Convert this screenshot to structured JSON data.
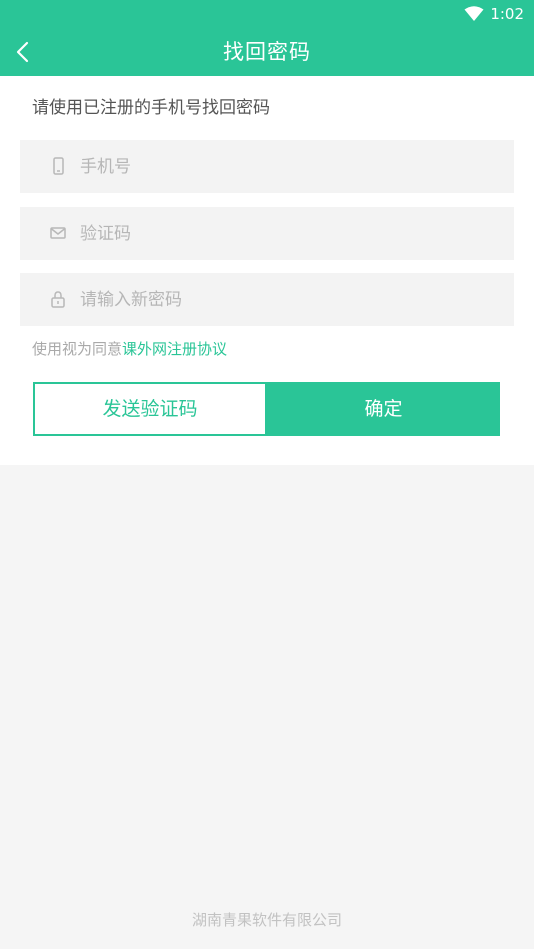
{
  "status_bar": {
    "time": "1:02",
    "wifi_icon": "wifi-icon",
    "background": "#2ac597"
  },
  "header": {
    "title": "找回密码",
    "back_icon": "chevron-left-icon"
  },
  "form": {
    "hint": "请使用已注册的手机号找回密码",
    "phone": {
      "placeholder": "手机号",
      "value": "",
      "icon": "phone-icon"
    },
    "code": {
      "placeholder": "验证码",
      "value": "",
      "icon": "mail-icon"
    },
    "password": {
      "placeholder": "请输入新密码",
      "value": "",
      "icon": "lock-icon"
    },
    "agreement_prefix": "使用视为同意",
    "agreement_link": "课外网注册协议",
    "send_code_label": "发送验证码",
    "confirm_label": "确定"
  },
  "footer": {
    "company": "湖南青果软件有限公司"
  },
  "colors": {
    "accent": "#2ac597",
    "field_bg": "#f3f3f3",
    "page_bg": "#f5f5f5"
  }
}
